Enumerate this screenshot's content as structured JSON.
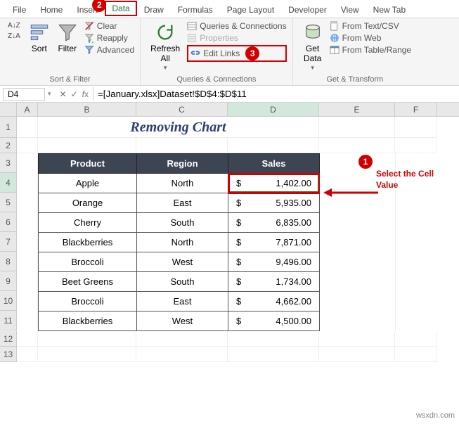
{
  "tabs": [
    "File",
    "Home",
    "Insert",
    "Data",
    "Draw",
    "Formulas",
    "Page Layout",
    "Developer",
    "View",
    "New Tab"
  ],
  "activeTab": "Data",
  "ribbon": {
    "sortFilterLabel": "Sort & Filter",
    "sort": "Sort",
    "filter": "Filter",
    "clear": "Clear",
    "reapply": "Reapply",
    "advanced": "Advanced",
    "queriesLabel": "Queries & Connections",
    "refreshAll": "Refresh\nAll",
    "qc": "Queries & Connections",
    "properties": "Properties",
    "editLinks": "Edit Links",
    "getTransformLabel": "Get & Transform",
    "getData": "Get\nData",
    "fromTextCsv": "From Text/CSV",
    "fromWeb": "From Web",
    "fromTable": "From Table/Range"
  },
  "namebox": "D4",
  "formula": "=[January.xlsx]Dataset!$D$4:$D$11",
  "title": "Removing Chart",
  "columns": [
    "A",
    "B",
    "C",
    "D",
    "E",
    "F"
  ],
  "headers": {
    "b": "Product",
    "c": "Region",
    "d": "Sales"
  },
  "rows": [
    {
      "b": "Apple",
      "c": "North",
      "d": "1,402.00"
    },
    {
      "b": "Orange",
      "c": "East",
      "d": "5,935.00"
    },
    {
      "b": "Cherry",
      "c": "South",
      "d": "6,835.00"
    },
    {
      "b": "Blackberries",
      "c": "North",
      "d": "7,871.00"
    },
    {
      "b": "Broccoli",
      "c": "West",
      "d": "9,496.00"
    },
    {
      "b": "Beet Greens",
      "c": "South",
      "d": "1,734.00"
    },
    {
      "b": "Broccoli",
      "c": "East",
      "d": "4,662.00"
    },
    {
      "b": "Blackberries",
      "c": "West",
      "d": "4,500.00"
    }
  ],
  "callouts": {
    "b1": "1",
    "b2": "2",
    "b3": "3",
    "text1a": "Select the Cell",
    "text1b": "Value"
  },
  "watermark": "wsxdn.com"
}
